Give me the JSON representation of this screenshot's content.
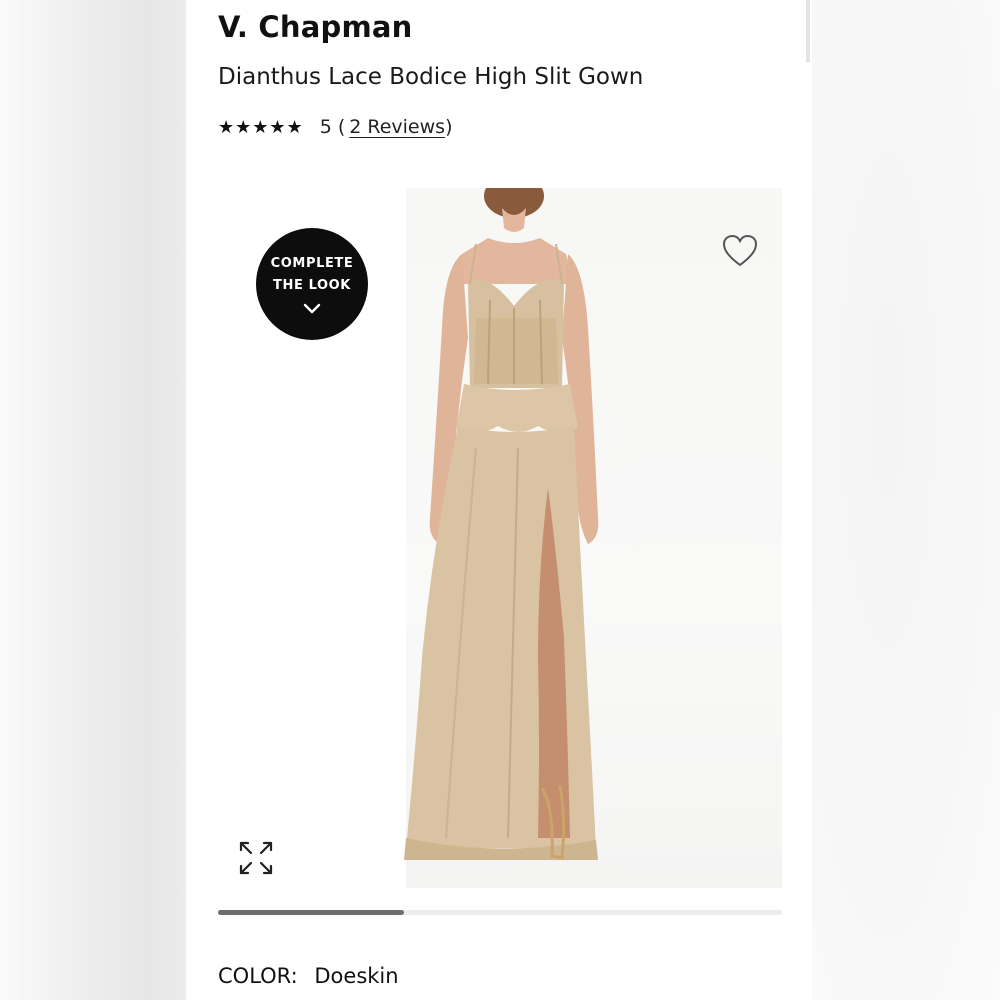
{
  "brand": "V. Chapman",
  "product": {
    "name": "Dianthus Lace Bodice High Slit Gown",
    "stars_icon": "★★★★★",
    "rating_value": "5 (",
    "reviews_link": "2 Reviews",
    "reviews_close": ")"
  },
  "image": {
    "complete_the_look_line1": "COMPLETE",
    "complete_the_look_line2": "THE LOOK",
    "wishlist_icon": "heart-outline-icon",
    "expand_icon": "expand-arrows-icon",
    "carousel_progress": 0.33
  },
  "color": {
    "label": "COLOR:",
    "value": "Doeskin"
  },
  "colors": {
    "gown": "#d9c3a3",
    "gown_shadow": "#c4ab88",
    "skin": "#e2b79d",
    "badge_bg": "#0d0d0d"
  }
}
